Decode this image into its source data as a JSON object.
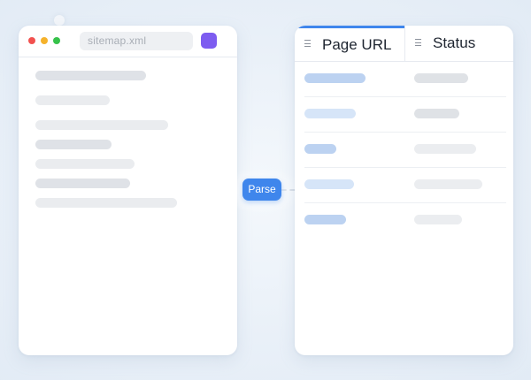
{
  "browser": {
    "address_bar": "sitemap.xml",
    "traffic_lights": [
      "close",
      "minimize",
      "maximize"
    ],
    "extension_color": "#7d5cf0"
  },
  "action": {
    "parse_label": "Parse",
    "accent": "#3f86ec"
  },
  "table": {
    "columns": [
      {
        "label": "Page URL",
        "icon": "menu-lines-icon",
        "active": true
      },
      {
        "label": "Status",
        "icon": "menu-lines-icon",
        "active": false
      }
    ],
    "row_count": 5
  },
  "colors": {
    "background": "#e8eff7",
    "panel": "#ffffff",
    "url_placeholder": "#bcd2f1",
    "status_placeholder": "#dfe2e6"
  }
}
